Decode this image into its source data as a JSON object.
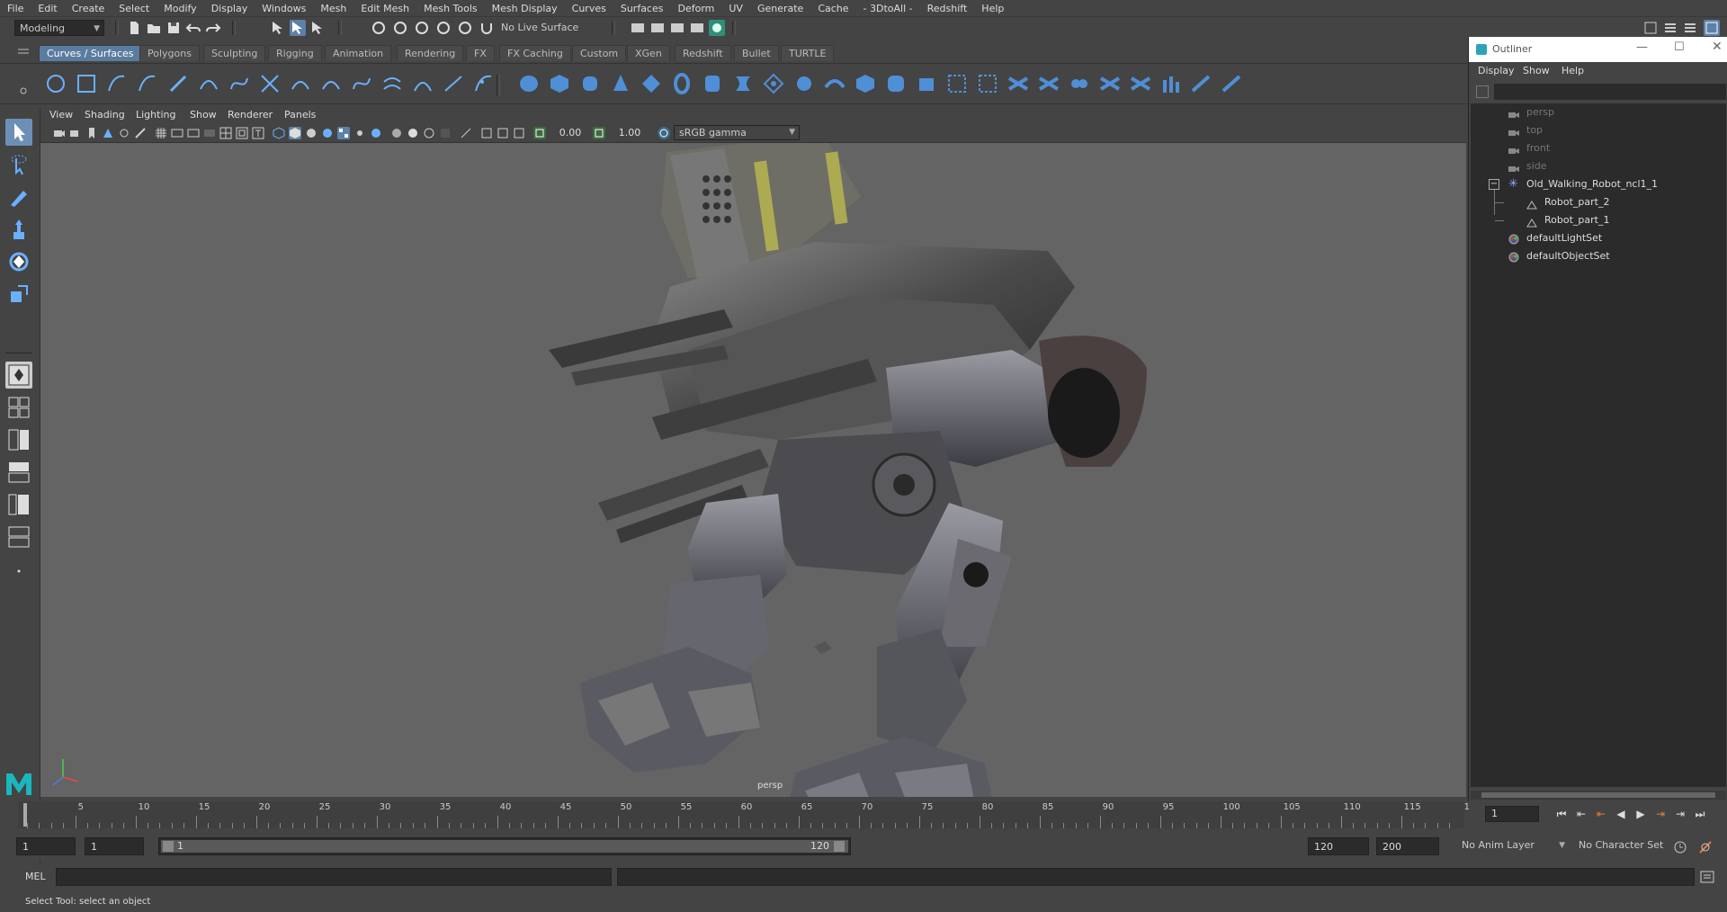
{
  "menubar": {
    "items": [
      "File",
      "Edit",
      "Create",
      "Select",
      "Modify",
      "Display",
      "Windows",
      "Mesh",
      "Edit Mesh",
      "Mesh Tools",
      "Mesh Display",
      "Curves",
      "Surfaces",
      "Deform",
      "UV",
      "Generate",
      "Cache",
      "- 3DtoAll -",
      "Redshift",
      "Help"
    ]
  },
  "statusline": {
    "workspace": "Modeling",
    "live_surface": "No Live Surface"
  },
  "shelf": {
    "tabs": [
      "Curves / Surfaces",
      "Polygons",
      "Sculpting",
      "Rigging",
      "Animation",
      "Rendering",
      "FX",
      "FX Caching",
      "Custom",
      "XGen",
      "Redshift",
      "Bullet",
      "TURTLE"
    ],
    "active_tab": "Curves / Surfaces"
  },
  "viewport": {
    "menus": [
      "View",
      "Shading",
      "Lighting",
      "Show",
      "Renderer",
      "Panels"
    ],
    "exposure": "0.00",
    "gamma": "1.00",
    "color_space": "sRGB gamma",
    "camera_label": "persp"
  },
  "outliner": {
    "title": "Outliner",
    "menus": [
      "Display",
      "Show",
      "Help"
    ],
    "items": [
      {
        "label": "persp",
        "icon": "camera-icon",
        "dim": true
      },
      {
        "label": "top",
        "icon": "camera-icon",
        "dim": true
      },
      {
        "label": "front",
        "icon": "camera-icon",
        "dim": true
      },
      {
        "label": "side",
        "icon": "camera-icon",
        "dim": true
      },
      {
        "label": "Old_Walking_Robot_ncl1_1",
        "icon": "transform-icon",
        "dim": false
      },
      {
        "label": "Robot_part_2",
        "icon": "mesh-icon",
        "dim": false
      },
      {
        "label": "Robot_part_1",
        "icon": "mesh-icon",
        "dim": false
      },
      {
        "label": "defaultLightSet",
        "icon": "set-icon",
        "dim": false
      },
      {
        "label": "defaultObjectSet",
        "icon": "set-icon",
        "dim": false
      }
    ]
  },
  "timeline": {
    "labels": [
      "5",
      "10",
      "15",
      "20",
      "25",
      "30",
      "35",
      "40",
      "45",
      "50",
      "55",
      "60",
      "65",
      "70",
      "75",
      "80",
      "85",
      "90",
      "95",
      "100",
      "105",
      "110",
      "115",
      "1"
    ],
    "current_frame": "1",
    "current_frame_field": "1"
  },
  "range": {
    "start": "1",
    "playback_start": "1",
    "slider_start": "1",
    "slider_end": "120",
    "playback_end": "120",
    "end": "200",
    "anim_layer": "No Anim Layer",
    "character_set": "No Character Set"
  },
  "command": {
    "language": "MEL"
  },
  "help": {
    "text": "Select Tool: select an object"
  },
  "colors": {
    "accent": "#5d81a8",
    "viewport_bg": "#646464"
  }
}
